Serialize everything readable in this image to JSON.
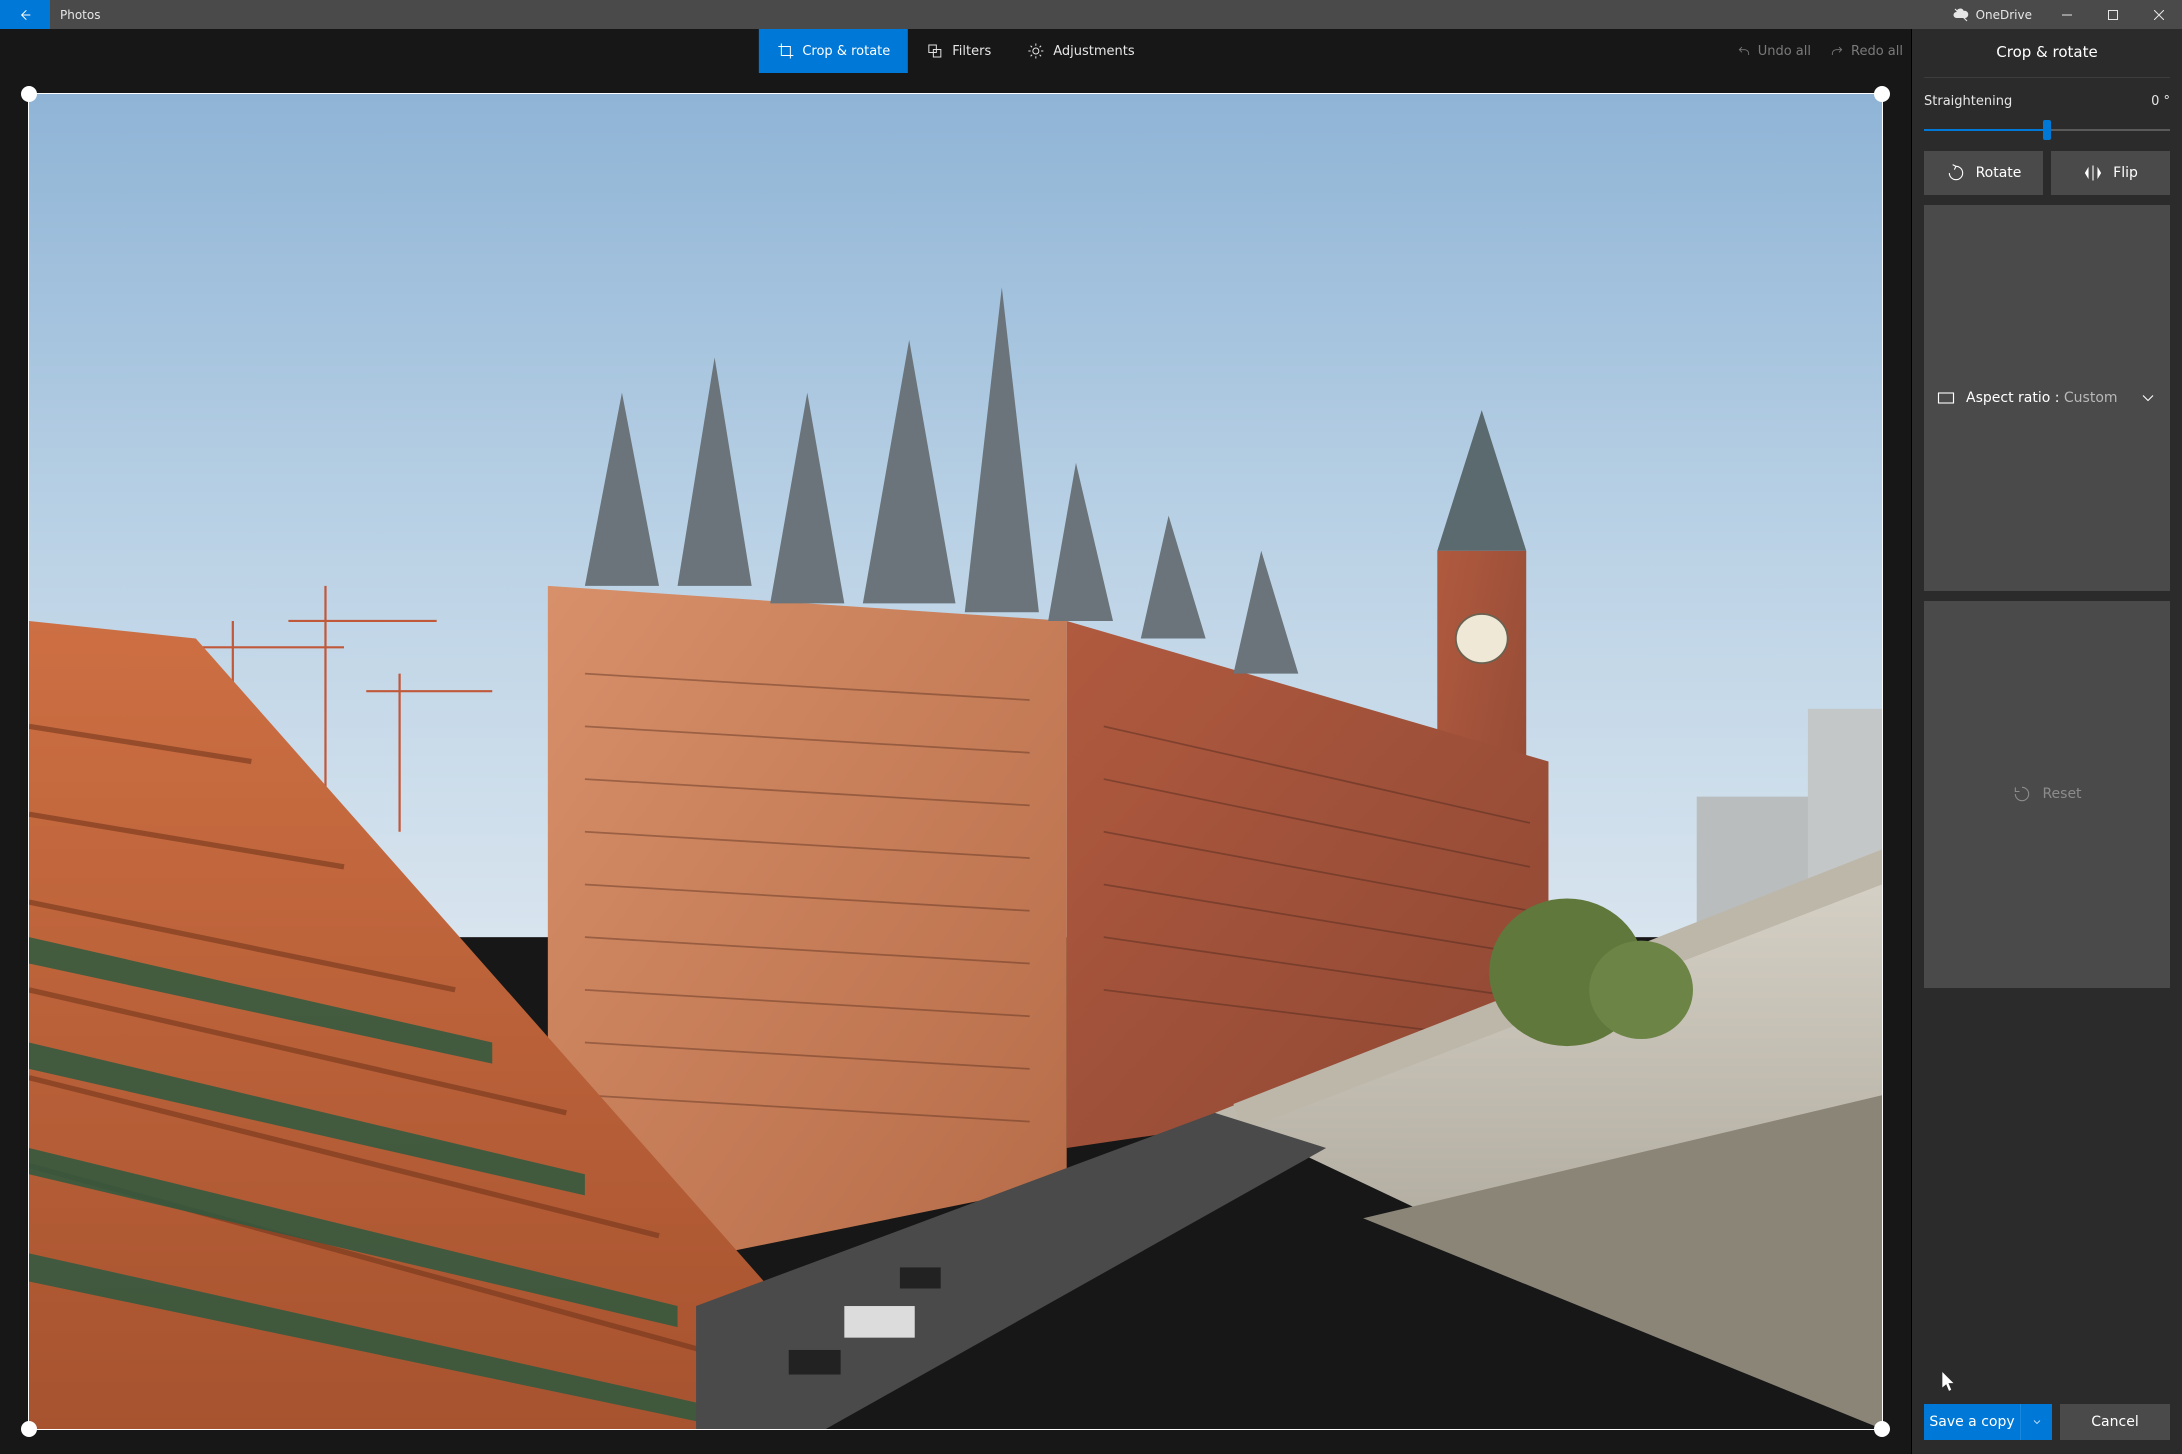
{
  "titlebar": {
    "app_name": "Photos",
    "onedrive_label": "OneDrive"
  },
  "toolbar": {
    "tabs": [
      {
        "label": "Crop & rotate"
      },
      {
        "label": "Filters"
      },
      {
        "label": "Adjustments"
      }
    ],
    "undo_label": "Undo all",
    "redo_label": "Redo all"
  },
  "side": {
    "title": "Crop & rotate",
    "straightening_label": "Straightening",
    "straightening_value": "0 °",
    "rotate_label": "Rotate",
    "flip_label": "Flip",
    "aspect_label": "Aspect ratio : ",
    "aspect_value": "Custom",
    "reset_label": "Reset",
    "save_label": "Save a copy",
    "cancel_label": "Cancel"
  }
}
